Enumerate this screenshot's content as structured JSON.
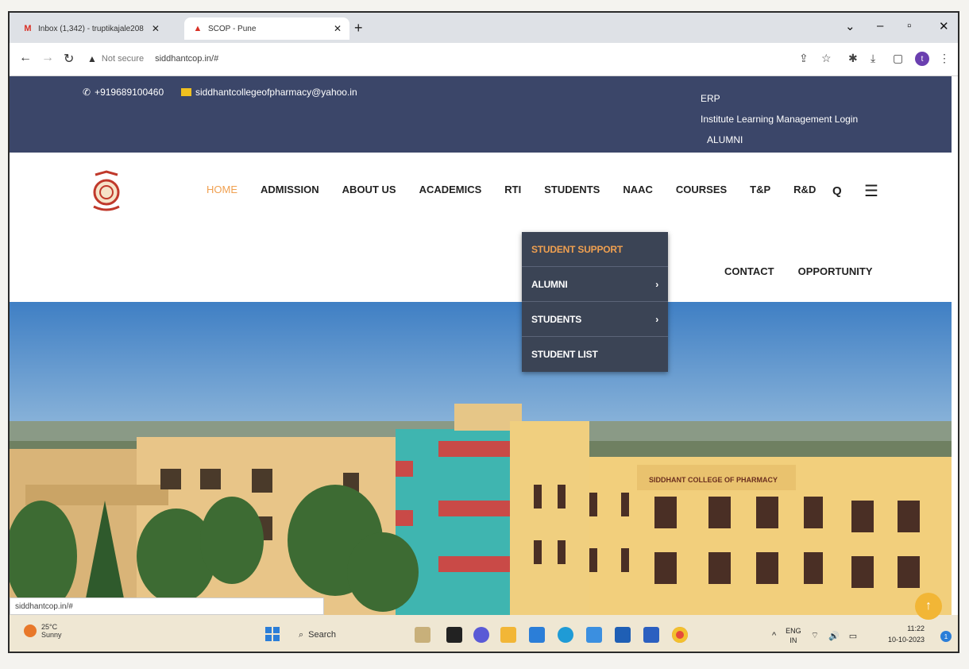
{
  "browser": {
    "tabs": [
      {
        "title": "Inbox (1,342) - truptikajale208",
        "icon": "gmail-icon",
        "active": false
      },
      {
        "title": "SCOP - Pune",
        "icon": "site-favicon",
        "active": true
      }
    ],
    "url": "siddhantcop.in/#",
    "security_label": "Not secure",
    "status_url": "siddhantcop.in/#"
  },
  "topbar": {
    "phone": "+919689100460",
    "email": "siddhantcollegeofpharmacy@yahoo.in",
    "links": [
      "ERP",
      "Institute Learning Management Login",
      "ALUMNI"
    ]
  },
  "nav": {
    "items": [
      "HOME",
      "ADMISSION",
      "ABOUT US",
      "ACADEMICS",
      "RTI",
      "STUDENTS",
      "NAAC",
      "COURSES",
      "T&P",
      "R&D"
    ],
    "row2": [
      "CONTACT",
      "OPPORTUNITY"
    ]
  },
  "dropdown": {
    "items": [
      {
        "label": "STUDENT SUPPORT",
        "has_submenu": false
      },
      {
        "label": "ALUMNI",
        "has_submenu": true
      },
      {
        "label": "STUDENTS",
        "has_submenu": true
      },
      {
        "label": "STUDENT LIST",
        "has_submenu": false
      }
    ]
  },
  "hero": {
    "building_sign": "SIDDHANT COLLEGE OF PHARMACY"
  },
  "taskbar": {
    "weather_temp": "25°C",
    "weather_desc": "Sunny",
    "search_label": "Search",
    "lang_top": "ENG",
    "lang_bottom": "IN",
    "time": "11:22",
    "date": "10-10-2023",
    "notification_count": "1"
  },
  "colors": {
    "topbar_bg": "#3b4669",
    "dropdown_bg": "#3b4455",
    "accent": "#f0a050"
  }
}
